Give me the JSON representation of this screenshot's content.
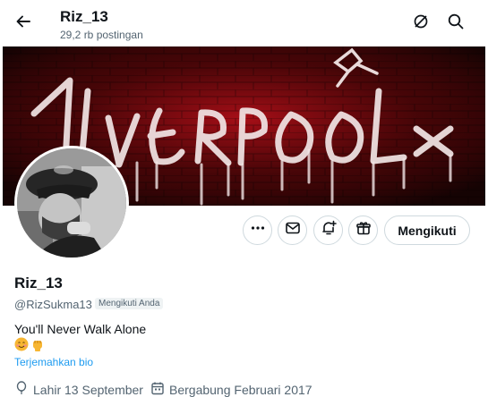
{
  "header": {
    "title": "Riz_13",
    "subtitle": "29,2 rb postingan"
  },
  "banner": {
    "text": "LIVERPOOL FC"
  },
  "actions": {
    "follow_label": "Mengikuti"
  },
  "profile": {
    "name": "Riz_13",
    "handle": "@RizSukma13",
    "follows_you": "Mengikuti Anda",
    "bio": "You'll Never Walk Alone",
    "translate_link": "Terjemahkan bio",
    "birthday": "Lahir 13 September",
    "joined": "Bergabung Februari 2017"
  },
  "colors": {
    "link": "#1d9bf0",
    "text_primary": "#0f1419",
    "text_secondary": "#536471",
    "border": "#cfd9de",
    "banner_bg": "#1a0606",
    "banner_glow": "#c0101a"
  },
  "icons": {
    "back": "arrow-left-icon",
    "refresh": "refresh-icon",
    "search": "search-icon",
    "more": "more-icon",
    "message": "mail-icon",
    "notify": "bell-plus-icon",
    "gift": "gift-icon",
    "birthday": "balloon-icon",
    "calendar": "calendar-icon"
  }
}
